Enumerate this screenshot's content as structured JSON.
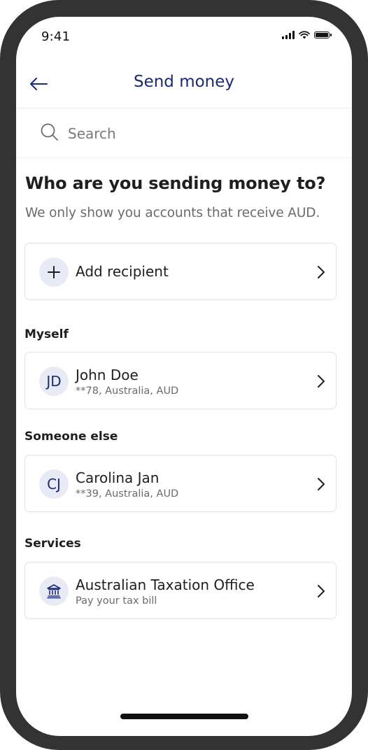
{
  "status_bar": {
    "time": "9:41"
  },
  "header": {
    "title": "Send money"
  },
  "search": {
    "placeholder": "Search"
  },
  "heading": "Who are you sending money to?",
  "subtext": "We only show you accounts that receive AUD.",
  "add_recipient": {
    "label": "Add recipient"
  },
  "sections": {
    "myself": {
      "label": "Myself",
      "recipient": {
        "initials": "JD",
        "name": "John Doe",
        "details": "**78, Australia, AUD"
      }
    },
    "someone_else": {
      "label": "Someone else",
      "recipient": {
        "initials": "CJ",
        "name": "Carolina Jan",
        "details": "**39, Australia, AUD"
      }
    },
    "services": {
      "label": "Services",
      "recipient": {
        "icon": "bank-icon",
        "name": "Australian Taxation Office",
        "details": "Pay your tax bill"
      }
    }
  },
  "colors": {
    "accent": "#1b2a73",
    "avatar_bg": "#e8ebf6",
    "card_border": "#dfe3ea",
    "frame": "#333333"
  }
}
